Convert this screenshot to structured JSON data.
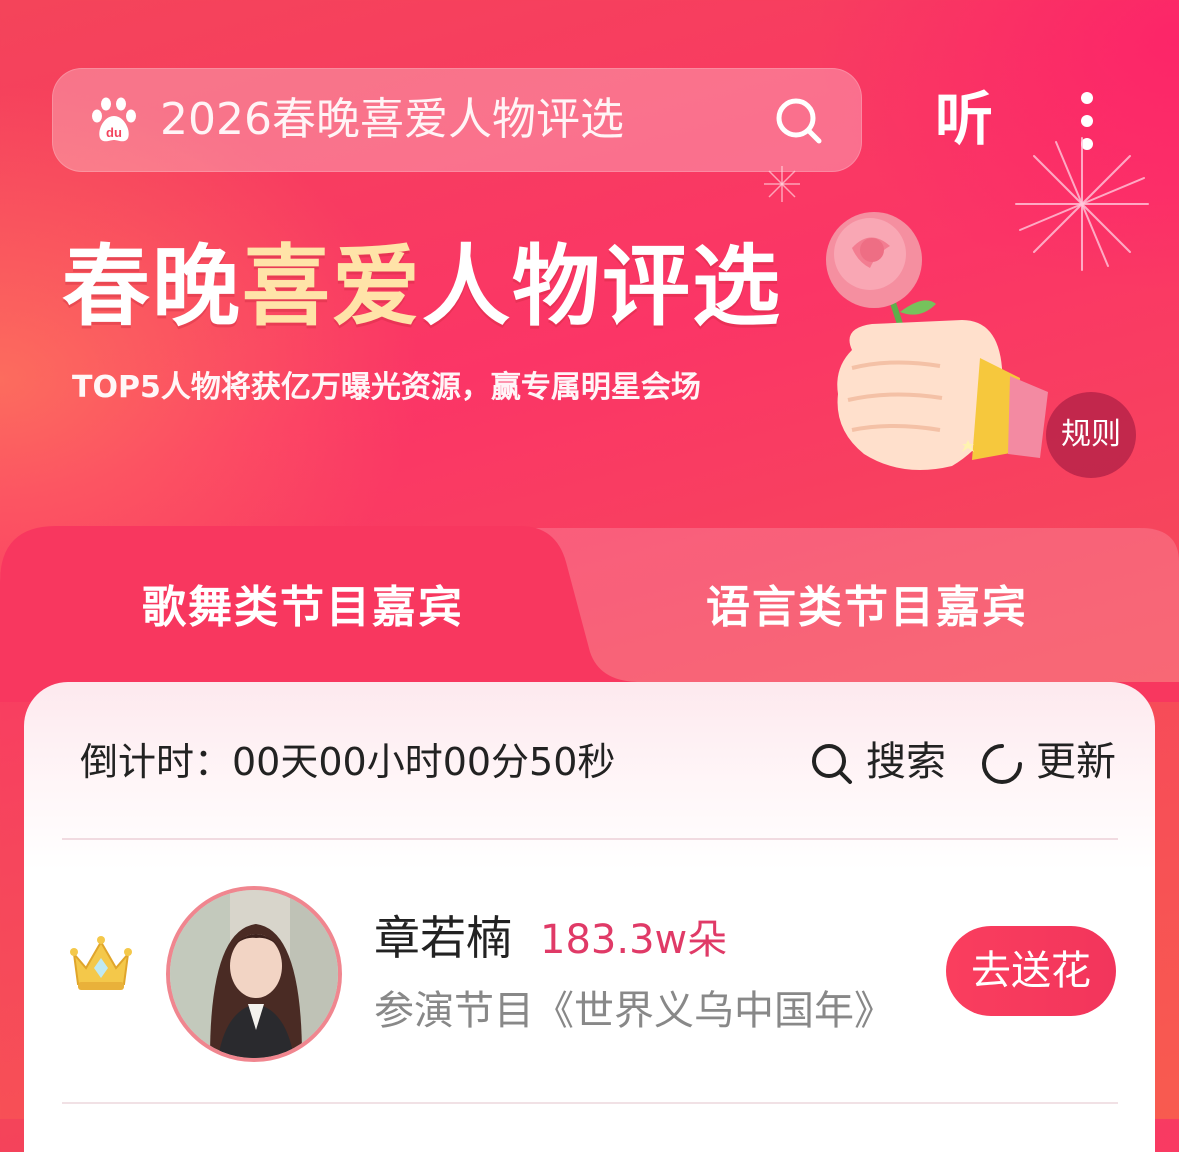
{
  "colors": {
    "accent": "#f2355c",
    "highlight": "#ffe3a8",
    "count": "#e03a67"
  },
  "header": {
    "search_text": "2026春晚喜爱人物评选",
    "logo_icon": "baidu-paw-icon",
    "search_icon": "search-icon",
    "listen_label": "听",
    "more_icon": "more-vertical-icon"
  },
  "hero": {
    "title_part1": "春晚",
    "title_highlight": "喜爱",
    "title_part2": "人物评选",
    "subtitle": "TOP5人物将获亿万曝光资源，赢专属明星会场",
    "rules_label": "规则",
    "illustration": "hand-holding-rose"
  },
  "tabs": [
    {
      "label": "歌舞类节目嘉宾",
      "active": true
    },
    {
      "label": "语言类节目嘉宾",
      "active": false
    }
  ],
  "card": {
    "countdown": "倒计时：00天00小时00分50秒",
    "search_label": "搜索",
    "refresh_label": "更新",
    "entries": [
      {
        "rank_icon": "crown-icon",
        "name": "章若楠",
        "flowers": "183.3w朵",
        "program": "参演节目《世界义乌中国年》",
        "button": "去送花"
      }
    ]
  }
}
